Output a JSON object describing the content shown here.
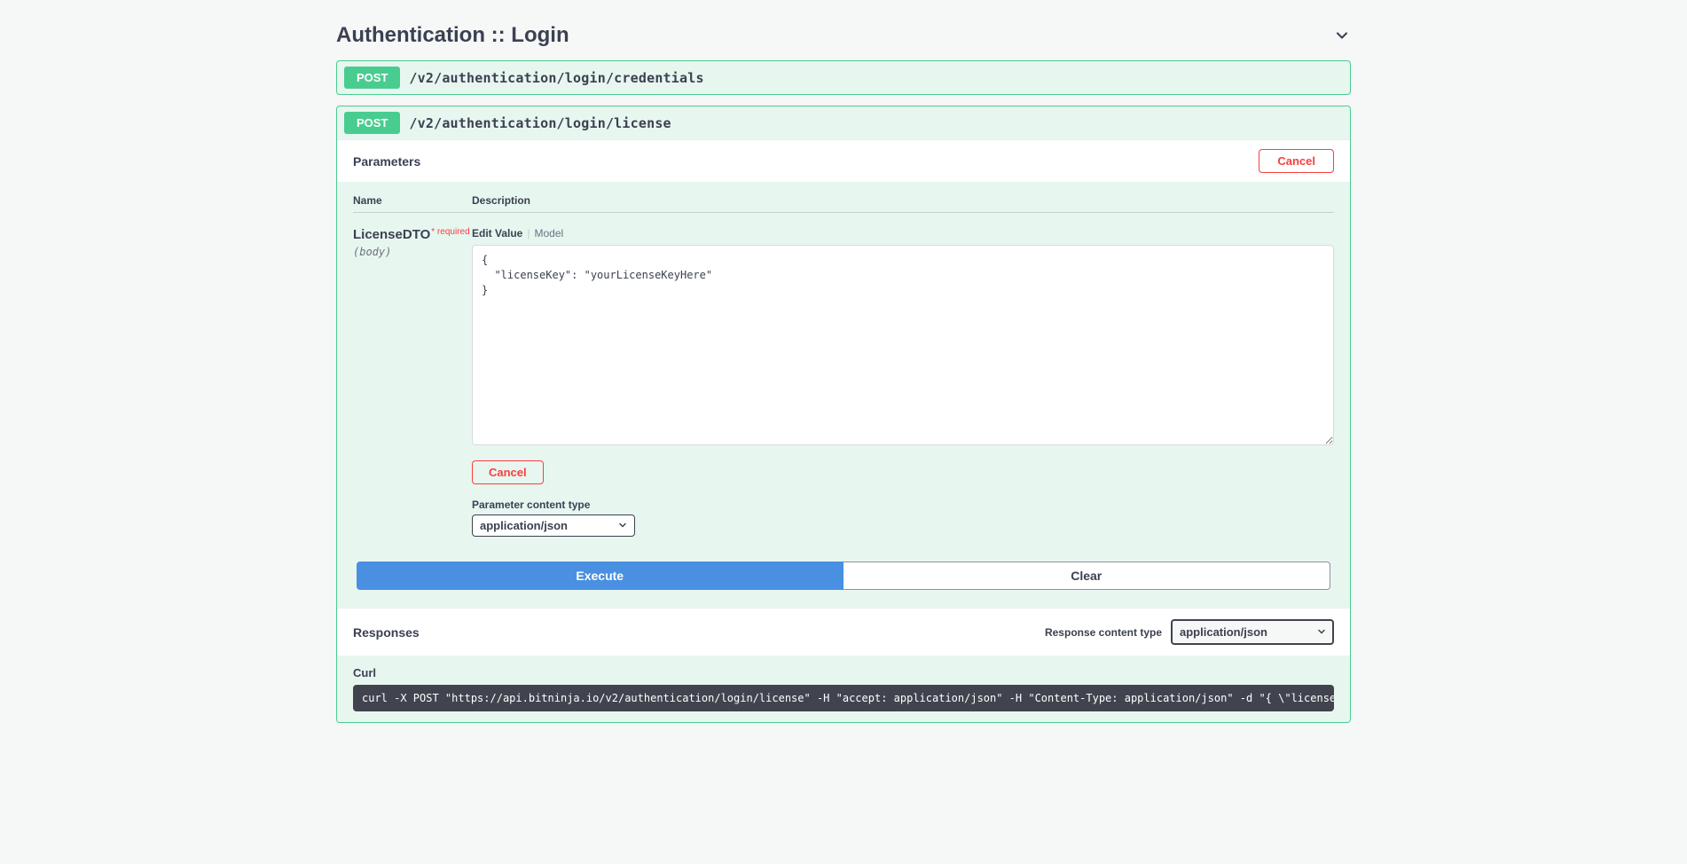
{
  "section": {
    "title": "Authentication :: Login"
  },
  "ops": [
    {
      "method": "POST",
      "path": "/v2/authentication/login/credentials"
    },
    {
      "method": "POST",
      "path": "/v2/authentication/login/license"
    }
  ],
  "parameters": {
    "header_label": "Parameters",
    "cancel_label": "Cancel",
    "columns": {
      "name": "Name",
      "description": "Description"
    },
    "row": {
      "name": "LicenseDTO",
      "required_marker": "* required",
      "in": "(body)"
    },
    "tabs": {
      "edit": "Edit Value",
      "model": "Model"
    },
    "body_value": "{\n  \"licenseKey\": \"yourLicenseKeyHere\"\n}",
    "body_cancel_label": "Cancel",
    "content_type_label": "Parameter content type",
    "content_type_value": "application/json"
  },
  "actions": {
    "execute": "Execute",
    "clear": "Clear"
  },
  "responses": {
    "header_label": "Responses",
    "content_type_label": "Response content type",
    "content_type_value": "application/json"
  },
  "curl": {
    "label": "Curl",
    "command": "curl -X POST \"https://api.bitninja.io/v2/authentication/login/license\" -H \"accept: application/json\" -H \"Content-Type: application/json\" -d \"{ \\\"licenseKey\\\": \\\"yourLicenseKeyHere\\\"}\""
  }
}
